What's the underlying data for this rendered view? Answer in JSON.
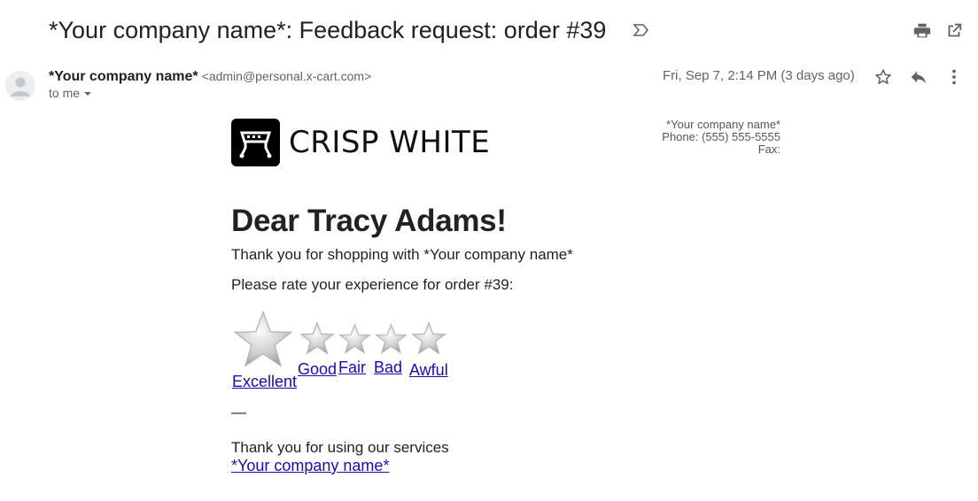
{
  "email": {
    "subject": "*Your company name*: Feedback request: order #39",
    "sender_name": "*Your company name*",
    "sender_email": "<admin@personal.x-cart.com>",
    "recipient_label": "to me",
    "date": "Fri, Sep 7, 2:14 PM (3 days ago)"
  },
  "icons": {
    "important": "important-marker-icon",
    "print": "print-icon",
    "open_new_window": "open-in-new-window-icon",
    "avatar": "avatar-icon",
    "star": "star-icon",
    "reply": "reply-icon",
    "more": "more-vert-icon",
    "logo": "crisp-white-logo-icon",
    "rating_star": "rating-star-icon"
  },
  "body": {
    "logo_text": "CRISP WHITE",
    "company_info": {
      "name": "*Your company name*",
      "phone": "Phone: (555) 555-5555",
      "fax": "Fax:"
    },
    "greeting": "Dear Tracy Adams!",
    "thanks_line": "Thank you for shopping with *Your company name*",
    "rate_prompt": "Please rate your experience for order #39:",
    "ratings": [
      "Excellent",
      "Good",
      "Fair",
      "Bad",
      "Awful"
    ],
    "closing_dash": "—",
    "closing": "Thank you for using our services",
    "signature_link": "*Your company name*"
  },
  "colors": {
    "link": "#1a0dab",
    "text": "#202124",
    "secondary_text": "#5f6368",
    "logo_bg": "#000000"
  }
}
